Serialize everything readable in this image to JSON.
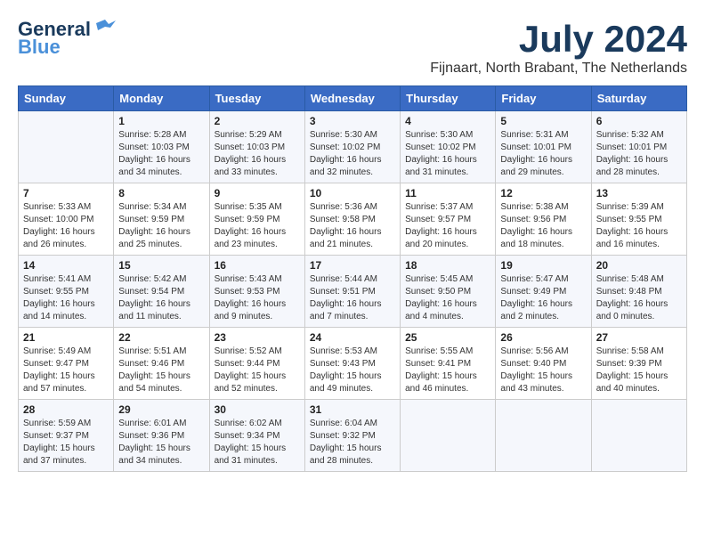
{
  "header": {
    "logo_line1": "General",
    "logo_line2": "Blue",
    "month_year": "July 2024",
    "location": "Fijnaart, North Brabant, The Netherlands"
  },
  "days_of_week": [
    "Sunday",
    "Monday",
    "Tuesday",
    "Wednesday",
    "Thursday",
    "Friday",
    "Saturday"
  ],
  "weeks": [
    [
      {
        "day": "",
        "info": ""
      },
      {
        "day": "1",
        "info": "Sunrise: 5:28 AM\nSunset: 10:03 PM\nDaylight: 16 hours\nand 34 minutes."
      },
      {
        "day": "2",
        "info": "Sunrise: 5:29 AM\nSunset: 10:03 PM\nDaylight: 16 hours\nand 33 minutes."
      },
      {
        "day": "3",
        "info": "Sunrise: 5:30 AM\nSunset: 10:02 PM\nDaylight: 16 hours\nand 32 minutes."
      },
      {
        "day": "4",
        "info": "Sunrise: 5:30 AM\nSunset: 10:02 PM\nDaylight: 16 hours\nand 31 minutes."
      },
      {
        "day": "5",
        "info": "Sunrise: 5:31 AM\nSunset: 10:01 PM\nDaylight: 16 hours\nand 29 minutes."
      },
      {
        "day": "6",
        "info": "Sunrise: 5:32 AM\nSunset: 10:01 PM\nDaylight: 16 hours\nand 28 minutes."
      }
    ],
    [
      {
        "day": "7",
        "info": "Sunrise: 5:33 AM\nSunset: 10:00 PM\nDaylight: 16 hours\nand 26 minutes."
      },
      {
        "day": "8",
        "info": "Sunrise: 5:34 AM\nSunset: 9:59 PM\nDaylight: 16 hours\nand 25 minutes."
      },
      {
        "day": "9",
        "info": "Sunrise: 5:35 AM\nSunset: 9:59 PM\nDaylight: 16 hours\nand 23 minutes."
      },
      {
        "day": "10",
        "info": "Sunrise: 5:36 AM\nSunset: 9:58 PM\nDaylight: 16 hours\nand 21 minutes."
      },
      {
        "day": "11",
        "info": "Sunrise: 5:37 AM\nSunset: 9:57 PM\nDaylight: 16 hours\nand 20 minutes."
      },
      {
        "day": "12",
        "info": "Sunrise: 5:38 AM\nSunset: 9:56 PM\nDaylight: 16 hours\nand 18 minutes."
      },
      {
        "day": "13",
        "info": "Sunrise: 5:39 AM\nSunset: 9:55 PM\nDaylight: 16 hours\nand 16 minutes."
      }
    ],
    [
      {
        "day": "14",
        "info": "Sunrise: 5:41 AM\nSunset: 9:55 PM\nDaylight: 16 hours\nand 14 minutes."
      },
      {
        "day": "15",
        "info": "Sunrise: 5:42 AM\nSunset: 9:54 PM\nDaylight: 16 hours\nand 11 minutes."
      },
      {
        "day": "16",
        "info": "Sunrise: 5:43 AM\nSunset: 9:53 PM\nDaylight: 16 hours\nand 9 minutes."
      },
      {
        "day": "17",
        "info": "Sunrise: 5:44 AM\nSunset: 9:51 PM\nDaylight: 16 hours\nand 7 minutes."
      },
      {
        "day": "18",
        "info": "Sunrise: 5:45 AM\nSunset: 9:50 PM\nDaylight: 16 hours\nand 4 minutes."
      },
      {
        "day": "19",
        "info": "Sunrise: 5:47 AM\nSunset: 9:49 PM\nDaylight: 16 hours\nand 2 minutes."
      },
      {
        "day": "20",
        "info": "Sunrise: 5:48 AM\nSunset: 9:48 PM\nDaylight: 16 hours\nand 0 minutes."
      }
    ],
    [
      {
        "day": "21",
        "info": "Sunrise: 5:49 AM\nSunset: 9:47 PM\nDaylight: 15 hours\nand 57 minutes."
      },
      {
        "day": "22",
        "info": "Sunrise: 5:51 AM\nSunset: 9:46 PM\nDaylight: 15 hours\nand 54 minutes."
      },
      {
        "day": "23",
        "info": "Sunrise: 5:52 AM\nSunset: 9:44 PM\nDaylight: 15 hours\nand 52 minutes."
      },
      {
        "day": "24",
        "info": "Sunrise: 5:53 AM\nSunset: 9:43 PM\nDaylight: 15 hours\nand 49 minutes."
      },
      {
        "day": "25",
        "info": "Sunrise: 5:55 AM\nSunset: 9:41 PM\nDaylight: 15 hours\nand 46 minutes."
      },
      {
        "day": "26",
        "info": "Sunrise: 5:56 AM\nSunset: 9:40 PM\nDaylight: 15 hours\nand 43 minutes."
      },
      {
        "day": "27",
        "info": "Sunrise: 5:58 AM\nSunset: 9:39 PM\nDaylight: 15 hours\nand 40 minutes."
      }
    ],
    [
      {
        "day": "28",
        "info": "Sunrise: 5:59 AM\nSunset: 9:37 PM\nDaylight: 15 hours\nand 37 minutes."
      },
      {
        "day": "29",
        "info": "Sunrise: 6:01 AM\nSunset: 9:36 PM\nDaylight: 15 hours\nand 34 minutes."
      },
      {
        "day": "30",
        "info": "Sunrise: 6:02 AM\nSunset: 9:34 PM\nDaylight: 15 hours\nand 31 minutes."
      },
      {
        "day": "31",
        "info": "Sunrise: 6:04 AM\nSunset: 9:32 PM\nDaylight: 15 hours\nand 28 minutes."
      },
      {
        "day": "",
        "info": ""
      },
      {
        "day": "",
        "info": ""
      },
      {
        "day": "",
        "info": ""
      }
    ]
  ]
}
